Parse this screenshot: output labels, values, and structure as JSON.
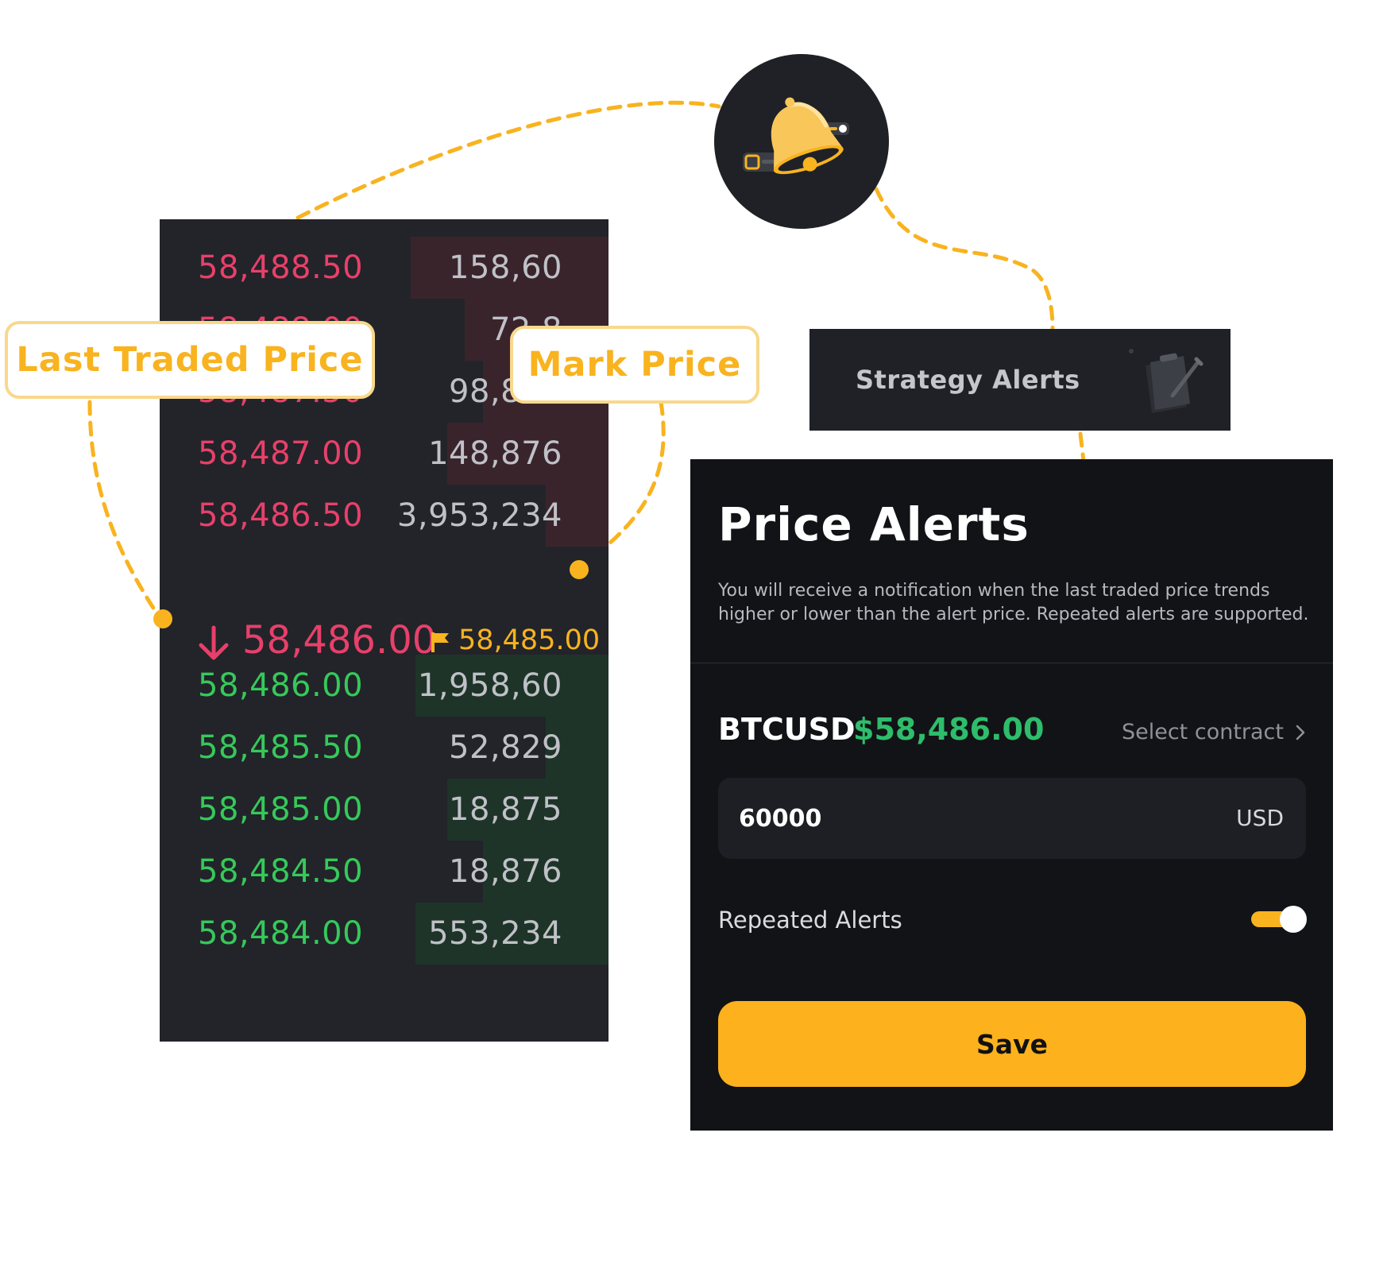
{
  "orderbook": {
    "asks": [
      {
        "price": "58,488.50",
        "size": "158,60"
      },
      {
        "price": "58,488.00",
        "size": "72,8"
      },
      {
        "price": "58,487.50",
        "size": "98,875"
      },
      {
        "price": "58,487.00",
        "size": "148,876"
      },
      {
        "price": "58,486.50",
        "size": "3,953,234"
      }
    ],
    "mid": {
      "last_price": "58,486.00",
      "mark_price": "58,485.00",
      "direction_icon": "arrow-down-icon",
      "mark_icon": "flag-icon"
    },
    "bids": [
      {
        "price": "58,486.00",
        "size": "1,958,60"
      },
      {
        "price": "58,485.50",
        "size": "52,829"
      },
      {
        "price": "58,485.00",
        "size": "18,875"
      },
      {
        "price": "58,484.50",
        "size": "18,876"
      },
      {
        "price": "58,484.00",
        "size": "553,234"
      }
    ],
    "ask_depth": [
      0.44,
      0.32,
      0.28,
      0.36,
      0.14
    ],
    "bid_depth": [
      0.43,
      0.14,
      0.36,
      0.28,
      0.43
    ]
  },
  "callouts": {
    "last_traded": "Last Traded Price",
    "mark": "Mark Price"
  },
  "strategy_card": {
    "label": "Strategy Alerts",
    "icon": "clipboard-icon"
  },
  "price_alerts": {
    "title": "Price Alerts",
    "description": "You will receive a notification when the last traded price trends higher or lower than the alert price. Repeated alerts are supported.",
    "symbol": "BTCUSD",
    "symbol_price": "$58,486.00",
    "select_contract": "Select contract",
    "price_input_value": "60000",
    "price_unit": "USD",
    "repeated_label": "Repeated Alerts",
    "repeated_enabled": true,
    "save_label": "Save"
  },
  "badge": {
    "icon": "bell-icon"
  },
  "colors": {
    "accent": "#f8b31f",
    "ask": "#e8406a",
    "bid": "#36c95a",
    "price_green": "#2ebd6b",
    "panel_bg": "#121316",
    "book_bg": "#22242a"
  }
}
